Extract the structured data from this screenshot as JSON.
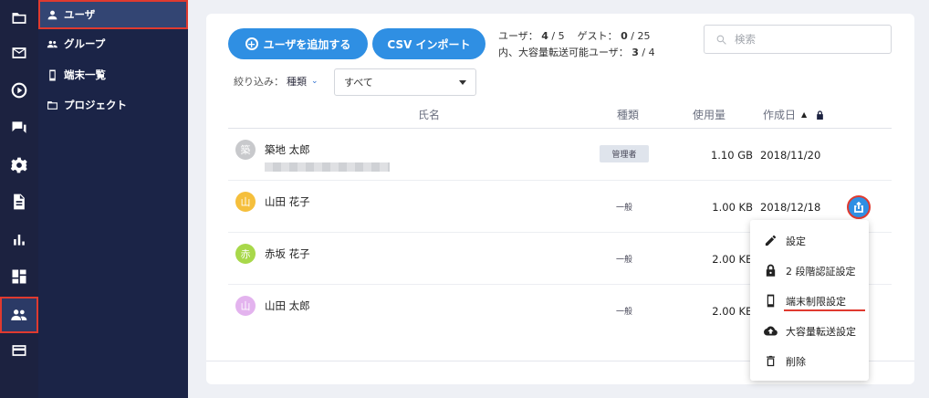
{
  "rail": {
    "icons": [
      "folder-icon",
      "mail-icon",
      "play-circle-icon",
      "chat-icon",
      "settings-icon",
      "document-icon",
      "bar-chart-icon",
      "dashboard-icon",
      "users-icon",
      "card-icon"
    ],
    "active": "users-icon"
  },
  "subnav": {
    "items": [
      {
        "label": "ユーザ",
        "icon": "person-icon",
        "active": true
      },
      {
        "label": "グループ",
        "icon": "group-icon"
      },
      {
        "label": "端末一覧",
        "icon": "phone-icon"
      },
      {
        "label": "プロジェクト",
        "icon": "folder-icon"
      }
    ]
  },
  "toolbar": {
    "add_user_label": "ユーザを追加する",
    "csv_import_label": "CSV インポート",
    "search_placeholder": "検索"
  },
  "counts": {
    "users_label": "ユーザ：",
    "users_current": "4",
    "users_max": "5",
    "guests_label": "ゲスト：",
    "guests_current": "0",
    "guests_max": "25",
    "large_transfer_label": "内、大容量転送可能ユーザ：",
    "large_transfer_current": "3",
    "large_transfer_max": "4"
  },
  "filter": {
    "label": "絞り込み：",
    "field": "種類",
    "selected": "すべて"
  },
  "table": {
    "columns": {
      "name": "氏名",
      "type": "種類",
      "usage": "使用量",
      "created": "作成日"
    },
    "rows": [
      {
        "avatar_char": "築",
        "avatar_color": "#c8c9cc",
        "name": "築地 太郎",
        "type": "管理者",
        "usage": "1.10 GB",
        "created": "2018/11/20"
      },
      {
        "avatar_char": "山",
        "avatar_color": "#f5bf3c",
        "name": "山田 花子",
        "type": "一般",
        "usage": "1.00 KB",
        "created": "2018/12/18"
      },
      {
        "avatar_char": "赤",
        "avatar_color": "#a8d84a",
        "name": "赤坂 花子",
        "type": "一般",
        "usage": "2.00 KB",
        "created": ""
      },
      {
        "avatar_char": "山",
        "avatar_color": "#e3b3ee",
        "name": "山田 太郎",
        "type": "一般",
        "usage": "2.00 KB",
        "created": ""
      }
    ]
  },
  "menu": {
    "items": [
      {
        "label": "設定",
        "icon": "pencil-icon"
      },
      {
        "label": "2 段階認証設定",
        "icon": "lock-icon"
      },
      {
        "label": "端末制限設定",
        "icon": "phone-icon"
      },
      {
        "label": "大容量転送設定",
        "icon": "cloud-upload-icon"
      },
      {
        "label": "削除",
        "icon": "trash-icon"
      }
    ]
  },
  "colors": {
    "accent": "#2f8fe3",
    "highlight": "#e03a2f",
    "sidebar": "#1b2447"
  }
}
